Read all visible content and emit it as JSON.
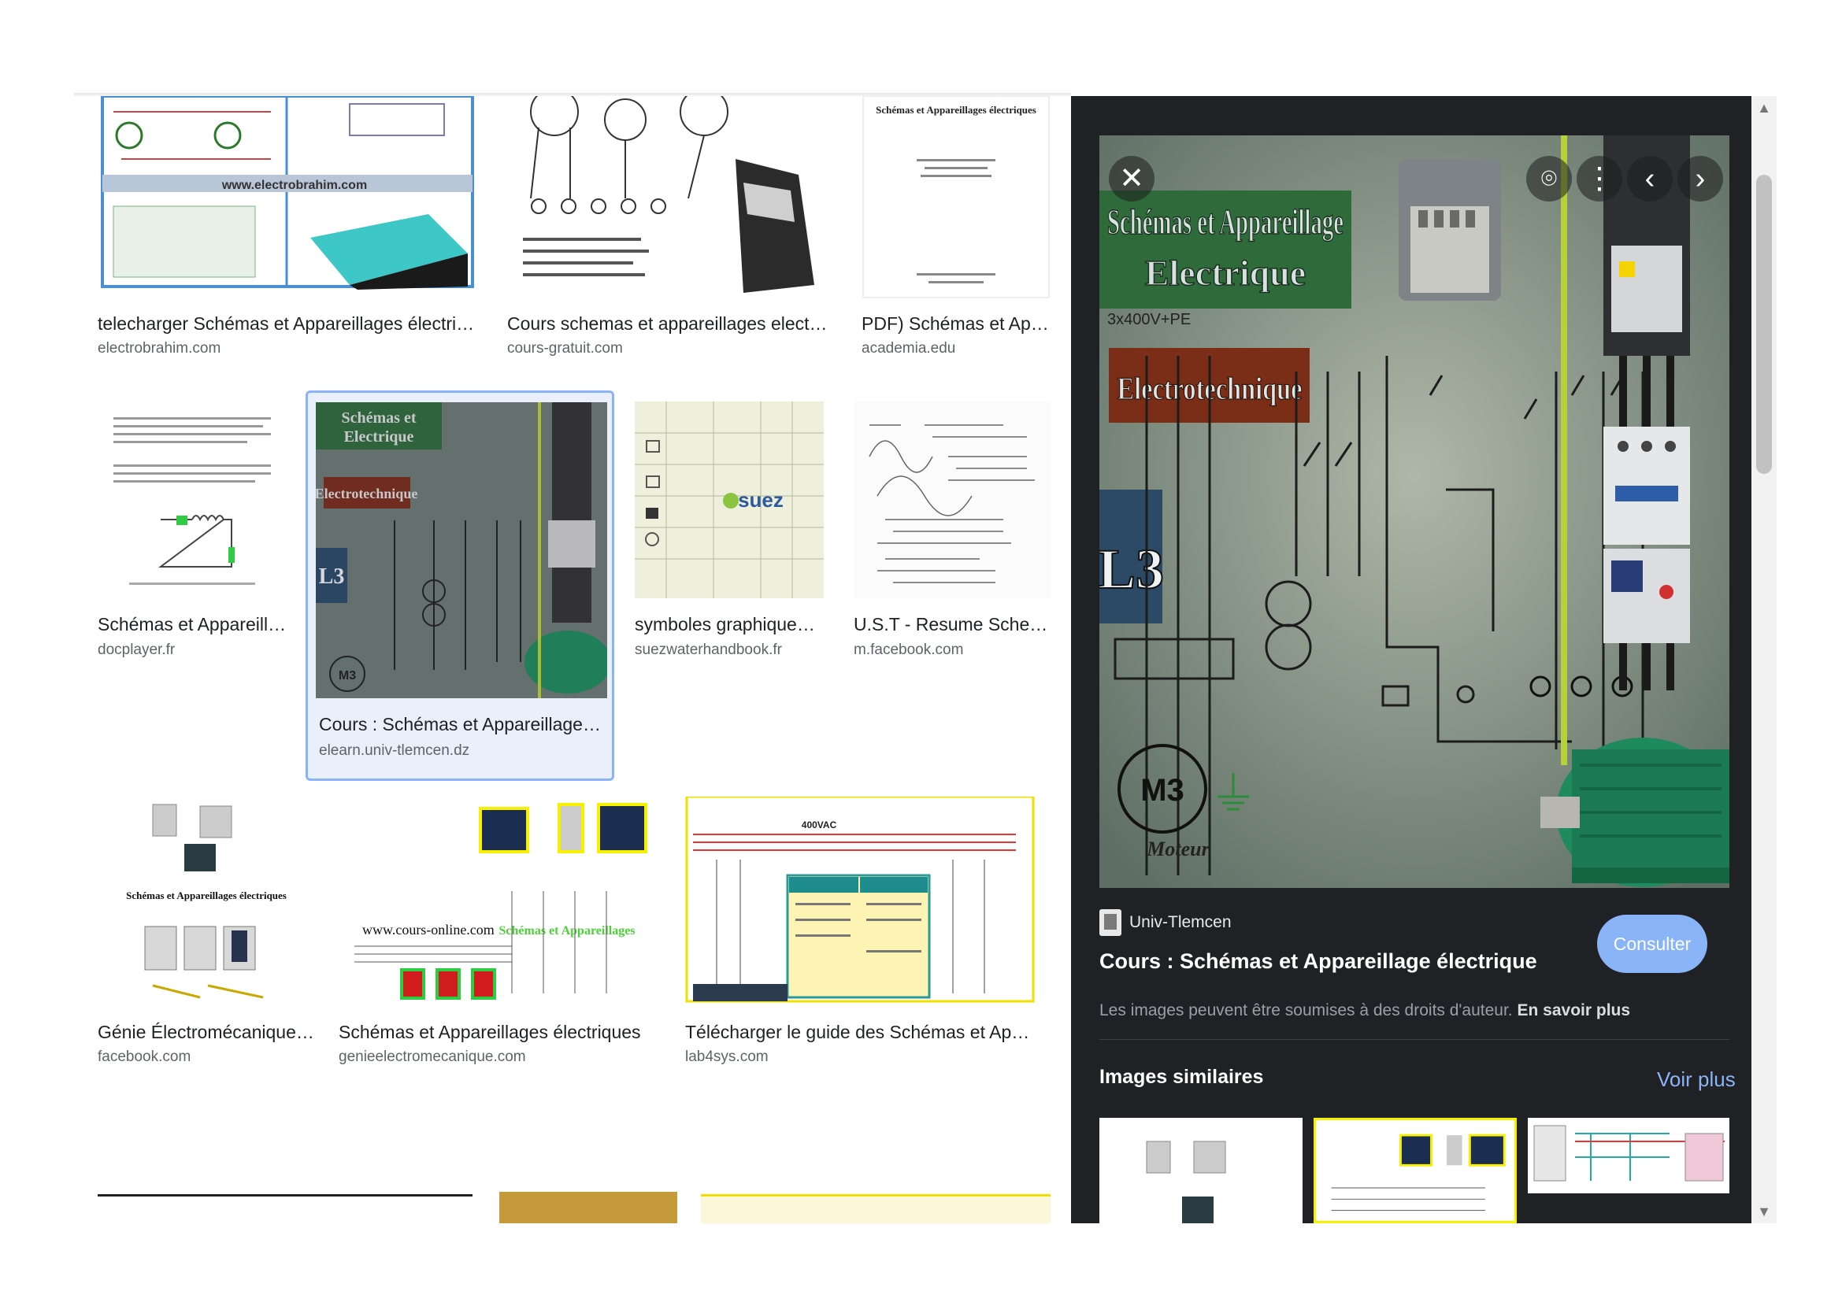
{
  "results": [
    {
      "title": "telecharger Schémas et Appareillages électriques",
      "source": "electrobrahim.com",
      "overlay": "www.electrobrahim.com"
    },
    {
      "title": "Cours schemas et appareillages electriques",
      "source": "cours-gratuit.com"
    },
    {
      "title": "PDF) Schémas et Apparei…",
      "source": "academia.edu",
      "overlay": "Schémas et Appareillages électriques"
    },
    {
      "title": "Schémas et Appareillages…",
      "source": "docplayer.fr"
    },
    {
      "title": "Cours : Schémas et Appareillage électriq…",
      "source": "elearn.univ-tlemcen.dz"
    },
    {
      "title": "symboles graphiques pour…",
      "source": "suezwaterhandbook.fr",
      "overlay": "suez"
    },
    {
      "title": "U.S.T - Resume Schema Ap…",
      "source": "m.facebook.com"
    },
    {
      "title": "Génie Électromécanique - Sch…",
      "source": "facebook.com",
      "overlay": "Schémas et Appareillages électriques"
    },
    {
      "title": "Schémas et Appareillages électriques",
      "source": "genieelectromecanique.com",
      "overlay": "www.cours-online.com"
    },
    {
      "title": "Télécharger le guide des Schémas et Appareillages …",
      "source": "lab4sys.com",
      "overlay": "400VAC"
    }
  ],
  "preview": {
    "image_text": {
      "line1": "Schémas et Appareillage",
      "line2": "Electrique",
      "voltage": "3x400V+PE",
      "subject": "Electrotechnique",
      "level": "L3",
      "motor": "M3",
      "motor_label": "Moteur"
    },
    "source_name": "Univ-Tlemcen",
    "title": "Cours : Schémas et Appareillage électrique",
    "consult_label": "Consulter",
    "rights_text": "Les images peuvent être soumises à des droits d'auteur.",
    "rights_link": "En savoir plus",
    "similar_title": "Images similaires",
    "similar_more": "Voir plus"
  },
  "icons": {
    "close": "✕",
    "lens": "⌾",
    "more": "⋮",
    "prev": "‹",
    "next": "›",
    "scroll_up": "▲",
    "scroll_down": "▼"
  },
  "colors": {
    "panel_bg": "#202124",
    "accent": "#8ab4f8",
    "selected_bg": "#e9effb"
  }
}
